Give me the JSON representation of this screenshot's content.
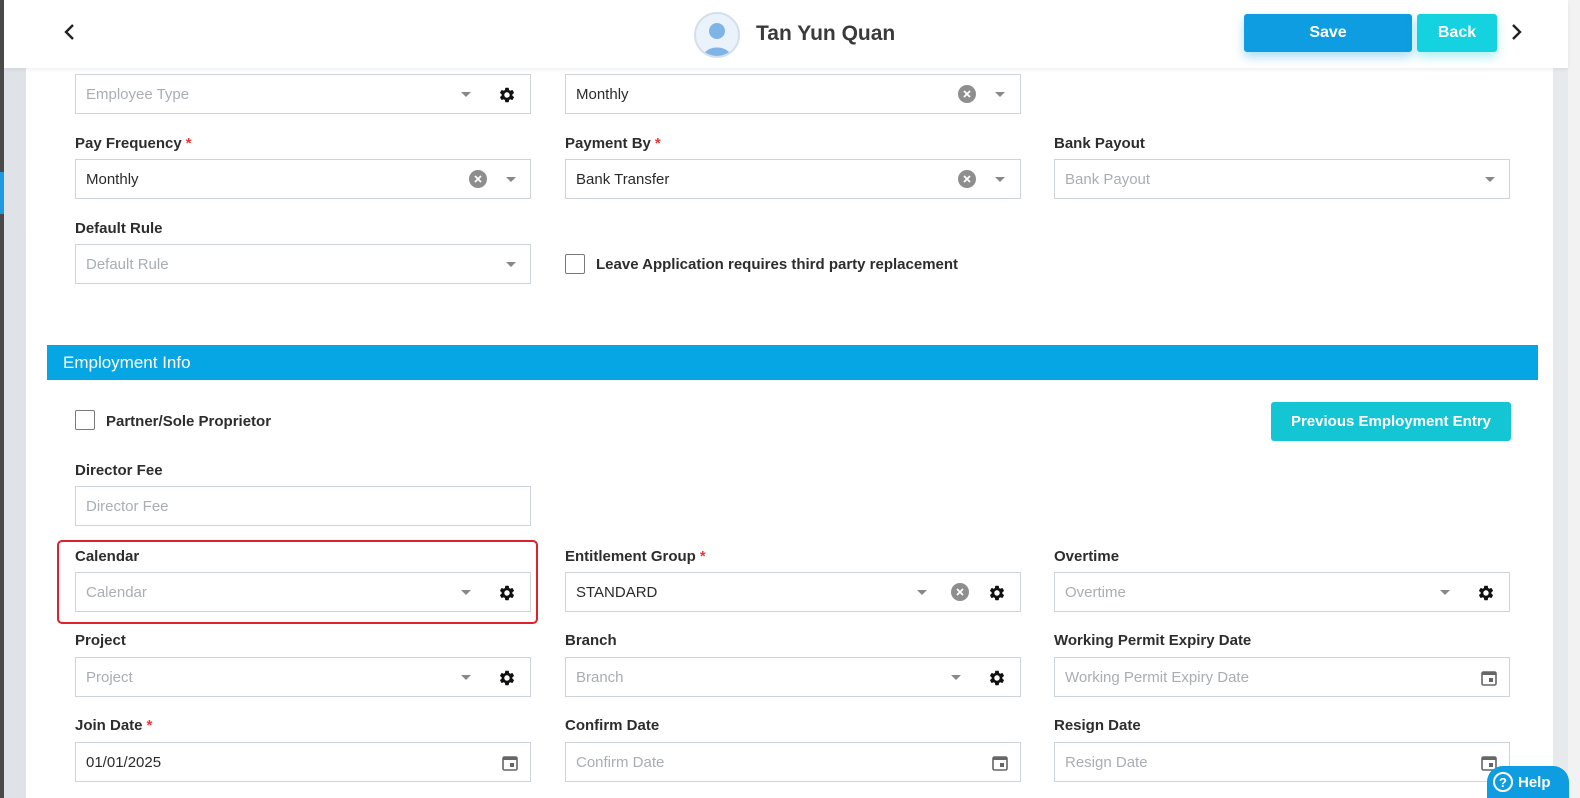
{
  "header": {
    "user_name": "Tan Yun Quan",
    "save_label": "Save",
    "back_label": "Back"
  },
  "payroll": {
    "employee_type": {
      "placeholder": "Employee Type"
    },
    "pay_method": {
      "value": "Monthly"
    },
    "pay_frequency": {
      "label": "Pay Frequency",
      "value": "Monthly",
      "required": "*"
    },
    "payment_by": {
      "label": "Payment By",
      "value": "Bank Transfer",
      "required": "*"
    },
    "bank_payout": {
      "label": "Bank Payout",
      "placeholder": "Bank Payout"
    },
    "default_rule": {
      "label": "Default Rule",
      "placeholder": "Default Rule"
    },
    "leave_replacement": {
      "label": "Leave Application requires third party replacement"
    }
  },
  "employment": {
    "section_title": "Employment Info",
    "partner": {
      "label": "Partner/Sole Proprietor"
    },
    "previous_entry_label": "Previous Employment Entry",
    "director_fee": {
      "label": "Director Fee",
      "placeholder": "Director Fee"
    },
    "calendar": {
      "label": "Calendar",
      "placeholder": "Calendar"
    },
    "entitlement_group": {
      "label": "Entitlement Group",
      "value": "STANDARD",
      "required": "*"
    },
    "overtime": {
      "label": "Overtime",
      "placeholder": "Overtime"
    },
    "project": {
      "label": "Project",
      "placeholder": "Project"
    },
    "branch": {
      "label": "Branch",
      "placeholder": "Branch"
    },
    "working_permit": {
      "label": "Working Permit Expiry Date",
      "placeholder": "Working Permit Expiry Date"
    },
    "join_date": {
      "label": "Join Date",
      "value": "01/01/2025",
      "required": "*"
    },
    "confirm_date": {
      "label": "Confirm Date",
      "placeholder": "Confirm Date"
    },
    "resign_date": {
      "label": "Resign Date",
      "placeholder": "Resign Date"
    }
  },
  "help": {
    "label": "Help",
    "glyph": "?"
  },
  "colors": {
    "primary": "#0d9de0",
    "accent": "#14d2e0",
    "section": "#06a5e4",
    "highlight": "#e0202a",
    "required": "#e53935"
  }
}
